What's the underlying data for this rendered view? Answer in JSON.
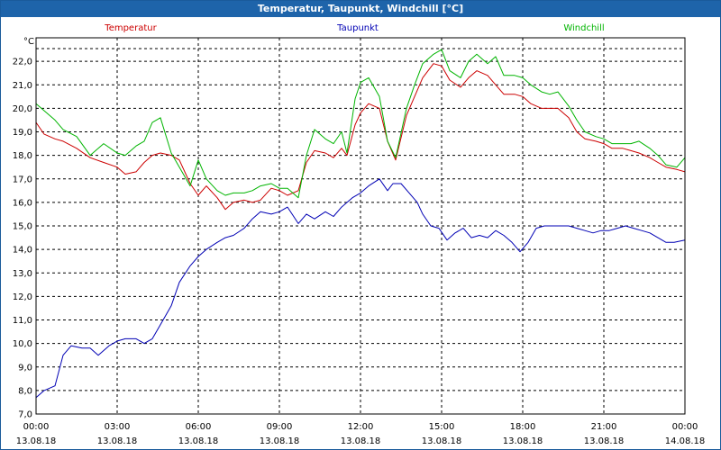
{
  "window": {
    "title": "Temperatur, Taupunkt, Windchill [°C]"
  },
  "colors": {
    "title_bar": "#1e64aa",
    "temperatur": "#cc0000",
    "taupunkt": "#0000b4",
    "windchill": "#00b400",
    "grid": "#000000"
  },
  "chart_data": {
    "type": "line",
    "title": "Temperatur, Taupunkt, Windchill [°C]",
    "ylabel": "°C",
    "ylim": [
      7.0,
      23.0
    ],
    "xlim": [
      0,
      24
    ],
    "grid": true,
    "legend_placement": "top",
    "y_ticks": [
      "7,0",
      "8,0",
      "9,0",
      "10,0",
      "11,0",
      "12,0",
      "13,0",
      "14,0",
      "15,0",
      "16,0",
      "17,0",
      "18,0",
      "19,0",
      "20,0",
      "21,0",
      "22,0"
    ],
    "x_ticks": [
      {
        "time": "00:00",
        "date": "13.08.18"
      },
      {
        "time": "03:00",
        "date": "13.08.18"
      },
      {
        "time": "06:00",
        "date": "13.08.18"
      },
      {
        "time": "09:00",
        "date": "13.08.18"
      },
      {
        "time": "12:00",
        "date": "13.08.18"
      },
      {
        "time": "15:00",
        "date": "13.08.18"
      },
      {
        "time": "18:00",
        "date": "13.08.18"
      },
      {
        "time": "21:00",
        "date": "13.08.18"
      },
      {
        "time": "00:00",
        "date": "14.08.18"
      }
    ],
    "series": [
      {
        "name": "Temperatur",
        "x": [
          0,
          0.3,
          0.7,
          1.0,
          1.5,
          2.0,
          2.5,
          3.0,
          3.3,
          3.7,
          4.0,
          4.3,
          4.6,
          5.0,
          5.3,
          5.7,
          6.0,
          6.3,
          6.7,
          7.0,
          7.3,
          7.7,
          8.0,
          8.3,
          8.7,
          9.0,
          9.3,
          9.7,
          10.0,
          10.3,
          10.7,
          11.0,
          11.3,
          11.5,
          11.8,
          12.0,
          12.3,
          12.7,
          13.0,
          13.3,
          13.7,
          14.0,
          14.3,
          14.7,
          15.0,
          15.3,
          15.7,
          16.0,
          16.3,
          16.7,
          17.0,
          17.3,
          17.7,
          18.0,
          18.3,
          18.7,
          19.0,
          19.3,
          19.7,
          20.0,
          20.3,
          20.7,
          21.0,
          21.3,
          21.7,
          22.0,
          22.3,
          22.7,
          23.0,
          23.3,
          23.7,
          24.0
        ],
        "values": [
          19.4,
          18.9,
          18.7,
          18.6,
          18.3,
          17.9,
          17.7,
          17.5,
          17.2,
          17.3,
          17.7,
          18.0,
          18.1,
          18.0,
          17.8,
          16.8,
          16.3,
          16.7,
          16.2,
          15.7,
          16.0,
          16.1,
          16.0,
          16.1,
          16.6,
          16.5,
          16.3,
          16.5,
          17.7,
          18.2,
          18.1,
          17.9,
          18.3,
          18.0,
          19.3,
          19.8,
          20.2,
          20.0,
          18.6,
          17.8,
          19.7,
          20.5,
          21.3,
          21.9,
          21.8,
          21.2,
          20.9,
          21.3,
          21.6,
          21.4,
          21.0,
          20.6,
          20.6,
          20.5,
          20.2,
          20.0,
          20.0,
          20.0,
          19.6,
          19.0,
          18.7,
          18.6,
          18.5,
          18.3,
          18.3,
          18.2,
          18.1,
          17.9,
          17.7,
          17.5,
          17.4,
          17.3
        ]
      },
      {
        "name": "Taupunkt",
        "x": [
          0,
          0.3,
          0.7,
          1.0,
          1.3,
          1.7,
          2.0,
          2.3,
          2.7,
          3.0,
          3.3,
          3.7,
          4.0,
          4.3,
          4.6,
          5.0,
          5.3,
          5.7,
          6.0,
          6.3,
          6.7,
          7.0,
          7.3,
          7.7,
          8.0,
          8.3,
          8.7,
          9.0,
          9.3,
          9.7,
          10.0,
          10.3,
          10.7,
          11.0,
          11.3,
          11.7,
          12.0,
          12.3,
          12.7,
          13.0,
          13.2,
          13.5,
          13.8,
          14.1,
          14.3,
          14.6,
          14.9,
          15.2,
          15.5,
          15.8,
          16.1,
          16.4,
          16.7,
          17.0,
          17.3,
          17.6,
          17.9,
          18.2,
          18.5,
          18.8,
          19.1,
          19.4,
          19.7,
          20.0,
          20.3,
          20.6,
          20.9,
          21.2,
          21.5,
          21.8,
          22.1,
          22.4,
          22.7,
          23.0,
          23.3,
          23.6,
          24.0
        ],
        "values": [
          7.7,
          8.0,
          8.2,
          9.5,
          9.9,
          9.8,
          9.8,
          9.5,
          9.9,
          10.1,
          10.2,
          10.2,
          10.0,
          10.2,
          10.8,
          11.6,
          12.6,
          13.3,
          13.7,
          14.0,
          14.3,
          14.5,
          14.6,
          14.9,
          15.3,
          15.6,
          15.5,
          15.6,
          15.8,
          15.1,
          15.5,
          15.3,
          15.6,
          15.4,
          15.8,
          16.2,
          16.4,
          16.7,
          17.0,
          16.5,
          16.8,
          16.8,
          16.4,
          16.0,
          15.5,
          15.0,
          14.9,
          14.4,
          14.7,
          14.9,
          14.5,
          14.6,
          14.5,
          14.8,
          14.6,
          14.3,
          13.9,
          14.3,
          14.9,
          15.0,
          15.0,
          15.0,
          15.0,
          14.9,
          14.8,
          14.7,
          14.8,
          14.8,
          14.9,
          15.0,
          14.9,
          14.8,
          14.7,
          14.5,
          14.3,
          14.3,
          14.4
        ]
      },
      {
        "name": "Windchill",
        "x": [
          0,
          0.3,
          0.7,
          1.0,
          1.5,
          2.0,
          2.5,
          3.0,
          3.3,
          3.7,
          4.0,
          4.3,
          4.6,
          5.0,
          5.3,
          5.7,
          6.0,
          6.3,
          6.7,
          7.0,
          7.3,
          7.7,
          8.0,
          8.3,
          8.7,
          9.0,
          9.3,
          9.7,
          10.0,
          10.3,
          10.7,
          11.0,
          11.3,
          11.5,
          11.8,
          12.0,
          12.3,
          12.7,
          13.0,
          13.3,
          13.7,
          14.0,
          14.3,
          14.7,
          15.0,
          15.3,
          15.7,
          16.0,
          16.3,
          16.7,
          17.0,
          17.3,
          17.7,
          18.0,
          18.3,
          18.7,
          19.0,
          19.3,
          19.7,
          20.0,
          20.3,
          20.7,
          21.0,
          21.3,
          21.7,
          22.0,
          22.3,
          22.7,
          23.0,
          23.3,
          23.7,
          24.0
        ],
        "values": [
          20.2,
          19.9,
          19.5,
          19.1,
          18.8,
          18.0,
          18.5,
          18.1,
          18.0,
          18.4,
          18.6,
          19.4,
          19.6,
          18.1,
          17.5,
          16.7,
          17.8,
          17.0,
          16.5,
          16.3,
          16.4,
          16.4,
          16.5,
          16.7,
          16.8,
          16.6,
          16.6,
          16.2,
          18.0,
          19.1,
          18.7,
          18.5,
          19.0,
          18.1,
          20.4,
          21.1,
          21.3,
          20.5,
          18.6,
          17.9,
          20.0,
          21.0,
          21.9,
          22.3,
          22.5,
          21.6,
          21.3,
          22.0,
          22.3,
          21.9,
          22.2,
          21.4,
          21.4,
          21.3,
          21.0,
          20.7,
          20.6,
          20.7,
          20.1,
          19.5,
          19.0,
          18.8,
          18.7,
          18.5,
          18.5,
          18.5,
          18.6,
          18.3,
          18.0,
          17.6,
          17.5,
          17.9
        ]
      }
    ]
  }
}
